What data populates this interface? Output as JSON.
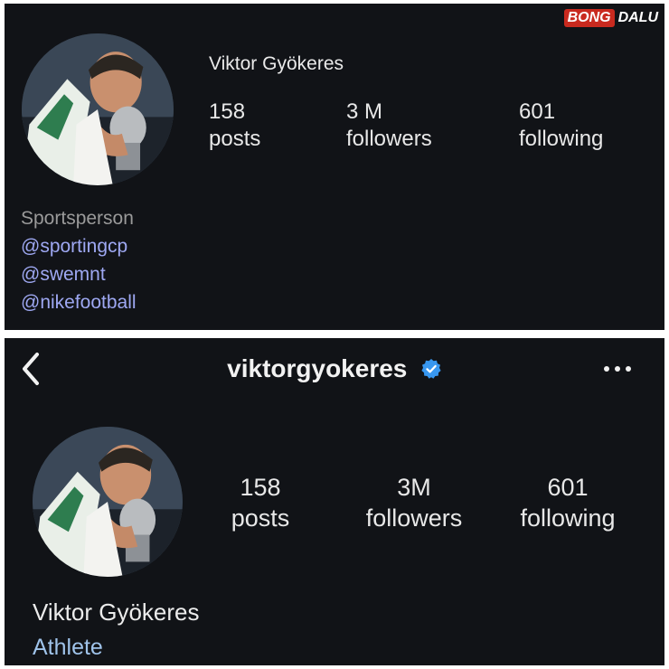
{
  "watermark": {
    "part1": "BONG",
    "part2": "DALU"
  },
  "top": {
    "name": "Viktor Gyökeres",
    "stats": [
      {
        "value": "158",
        "label": "posts"
      },
      {
        "value": "3 M",
        "label": "followers"
      },
      {
        "value": "601",
        "label": "following"
      }
    ],
    "bio": {
      "category": "Sportsperson",
      "links": [
        "@sportingcp",
        "@swemnt",
        "@nikefootball"
      ]
    }
  },
  "bottom": {
    "handle": "viktorgyokeres",
    "name": "Viktor Gyökeres",
    "category": "Athlete",
    "stats": [
      {
        "value": "158",
        "label": "posts"
      },
      {
        "value": "3M",
        "label": "followers"
      },
      {
        "value": "601",
        "label": "following"
      }
    ]
  },
  "icons": {
    "back": "chevron-left-icon",
    "verified": "verified-badge-icon",
    "more": "more-horizontal-icon"
  },
  "colors": {
    "background": "#111317",
    "link": "#9ea8f2",
    "category_bottom": "#9fc3ea",
    "verified": "#3897f0",
    "watermark_red": "#c92a1f"
  }
}
